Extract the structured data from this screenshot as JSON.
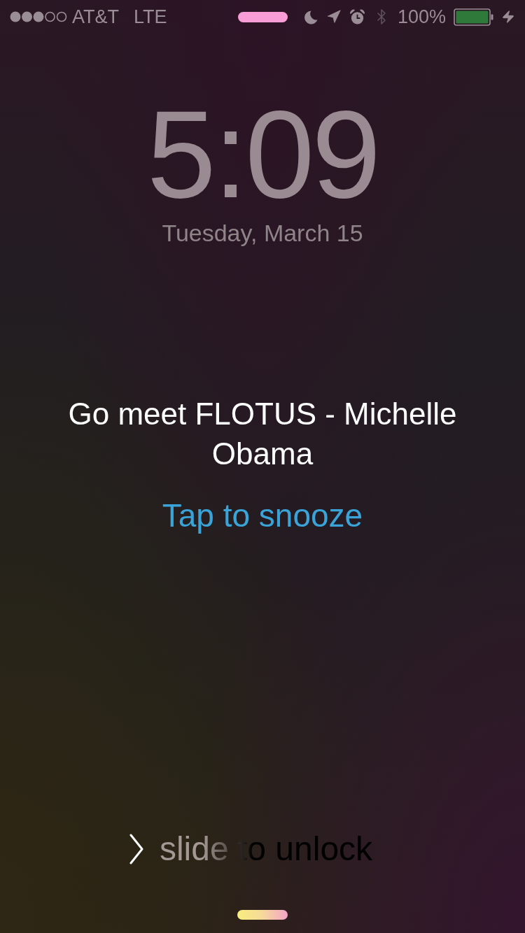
{
  "status_bar": {
    "carrier": "AT&T",
    "network": "LTE",
    "battery_percent": "100%"
  },
  "lock_screen": {
    "time": "5:09",
    "date": "Tuesday, March 15"
  },
  "alarm": {
    "title": "Go meet FLOTUS - Michelle Obama",
    "action": "Tap to snooze"
  },
  "unlock": {
    "label": "slide to unlock"
  }
}
